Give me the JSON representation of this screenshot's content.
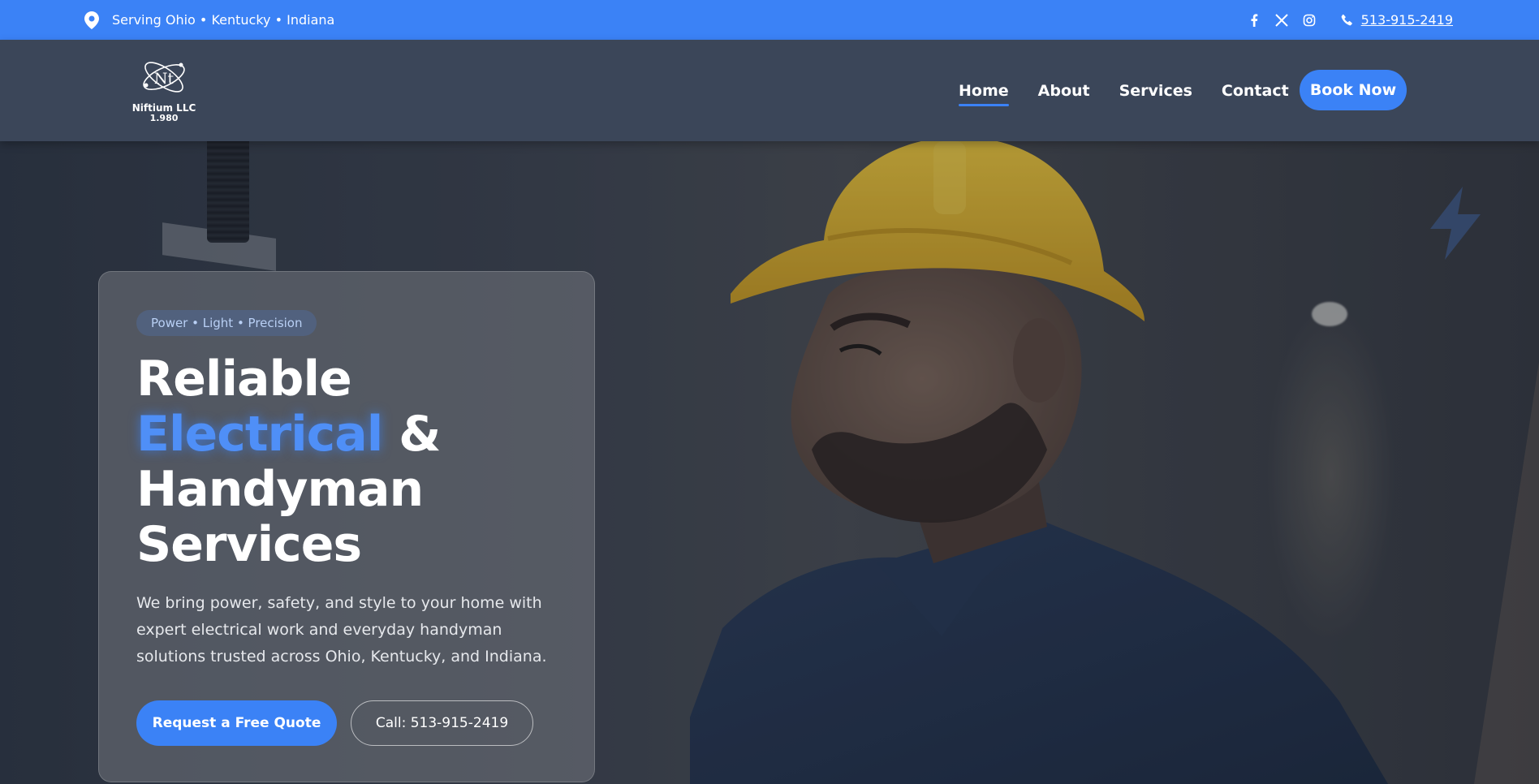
{
  "topbar": {
    "location_icon": "map-pin-icon",
    "service_area": "Serving Ohio • Kentucky • Indiana",
    "social": [
      "facebook-icon",
      "x-icon",
      "instagram-icon"
    ],
    "phone_icon": "phone-icon",
    "phone": "513-915-2419"
  },
  "header": {
    "logo": {
      "monogram": "Nt",
      "name": "Niftium LLC",
      "number": "1.980"
    },
    "nav": [
      {
        "label": "Home",
        "active": true
      },
      {
        "label": "About",
        "active": false
      },
      {
        "label": "Services",
        "active": false
      },
      {
        "label": "Contact",
        "active": false
      }
    ],
    "cta": "Book Now"
  },
  "hero": {
    "tagline": "Power • Light • Precision",
    "title_line1": "Reliable",
    "title_accent": "Electrical",
    "title_amp": "&",
    "title_line3": "Handyman",
    "title_line4": "Services",
    "description": "We bring power, safety, and style to your home with expert electrical work and everyday handyman solutions trusted across Ohio, Kentucky, and Indiana.",
    "primary_button": "Request a Free Quote",
    "secondary_button": "Call: 513-915-2419"
  },
  "colors": {
    "accent": "#3b82f6",
    "header_bg": "#3b4659",
    "helmet": "#e3b52a"
  }
}
